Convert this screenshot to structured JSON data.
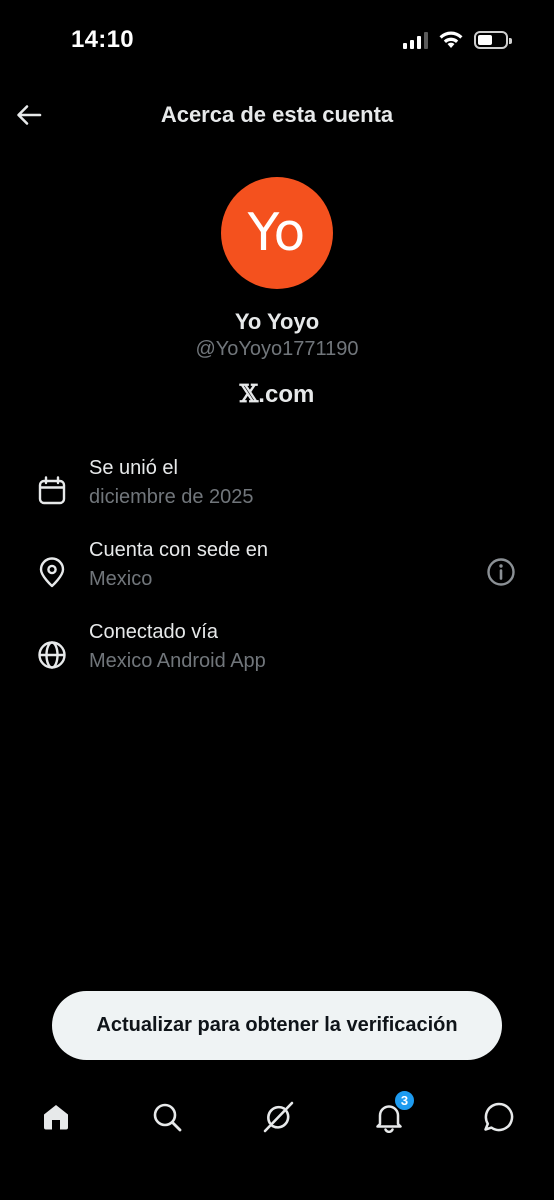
{
  "status_bar": {
    "time": "14:10",
    "icons": [
      "cellular-signal-icon",
      "wifi-icon",
      "battery-icon"
    ]
  },
  "header": {
    "back_icon": "arrow-left-icon",
    "title": "Acerca de esta cuenta"
  },
  "profile": {
    "avatar_initials": "Yo",
    "avatar_color": "#f4511e",
    "display_name": "Yo Yoyo",
    "handle": "@YoYoyo1771190",
    "site_logo": "𝕏",
    "site_suffix": ".com"
  },
  "info_rows": [
    {
      "icon": "calendar-icon",
      "title": "Se unió el",
      "value": "diciembre de 2025"
    },
    {
      "icon": "location-pin-icon",
      "title": "Cuenta con sede en",
      "value": "Mexico",
      "action_icon": "info-icon"
    },
    {
      "icon": "globe-icon",
      "title": "Conectado vía",
      "value": "Mexico Android App"
    }
  ],
  "verify_button": {
    "label": "Actualizar para obtener la verificación"
  },
  "bottom_nav": {
    "items": [
      {
        "name": "home",
        "icon": "home-icon"
      },
      {
        "name": "search",
        "icon": "search-icon"
      },
      {
        "name": "grok",
        "icon": "grok-icon"
      },
      {
        "name": "notifications",
        "icon": "bell-icon",
        "badge": "3"
      },
      {
        "name": "messages",
        "icon": "chat-bubble-icon"
      }
    ]
  },
  "colors": {
    "background": "#000000",
    "text_primary": "#e7e9ea",
    "text_secondary": "#71767b",
    "accent": "#1d9bf0",
    "pill_bg": "#eff3f4"
  }
}
